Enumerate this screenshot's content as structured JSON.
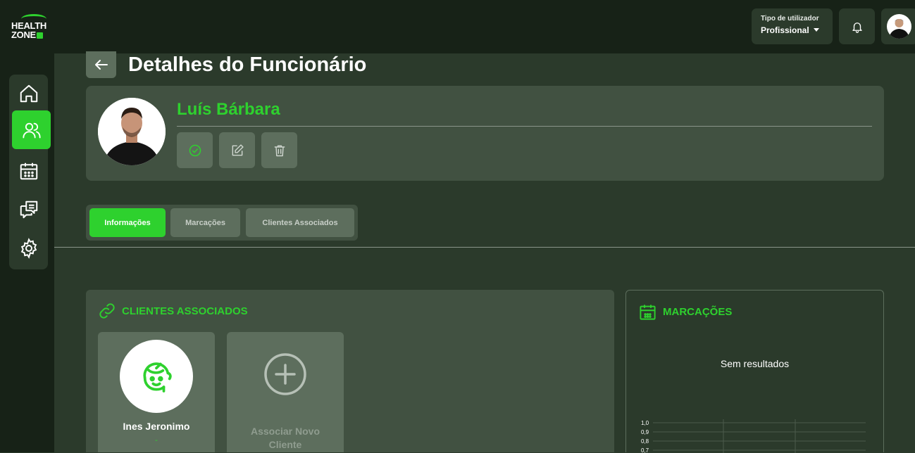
{
  "brand": {
    "line1": "HEALTH",
    "line2": "ZONE",
    "accent": "#2ed12e"
  },
  "header": {
    "user_type_label": "Tipo de utilizador",
    "user_type_value": "Profissional",
    "icons": [
      "bell-icon",
      "user-avatar"
    ]
  },
  "sidebar": {
    "items": [
      {
        "name": "home",
        "icon": "home-icon",
        "active": false
      },
      {
        "name": "users",
        "icon": "users-icon",
        "active": true
      },
      {
        "name": "calendar",
        "icon": "calendar-icon",
        "active": false
      },
      {
        "name": "messages",
        "icon": "chat-icon",
        "active": false
      },
      {
        "name": "settings",
        "icon": "gear-icon",
        "active": false
      }
    ]
  },
  "page": {
    "title": "Detalhes do Funcionário"
  },
  "profile": {
    "name": "Luís Bárbara",
    "actions": [
      "check-icon",
      "edit-icon",
      "trash-icon"
    ]
  },
  "tabs": [
    {
      "label": "Informações",
      "active": true
    },
    {
      "label": "Marcações",
      "active": false
    },
    {
      "label": "Clientes Associados",
      "active": false
    }
  ],
  "clients_section": {
    "title": "CLIENTES ASSOCIADOS",
    "clients": [
      {
        "name": "Ines Jeronimo",
        "sub": "-"
      }
    ],
    "add_label_1": "Associar Novo",
    "add_label_2": "Cliente"
  },
  "appointments_section": {
    "title": "MARCAÇÕES",
    "empty_text": "Sem resultados",
    "chart_ticks": [
      "1,0",
      "0,9",
      "0,8",
      "0,7"
    ]
  }
}
